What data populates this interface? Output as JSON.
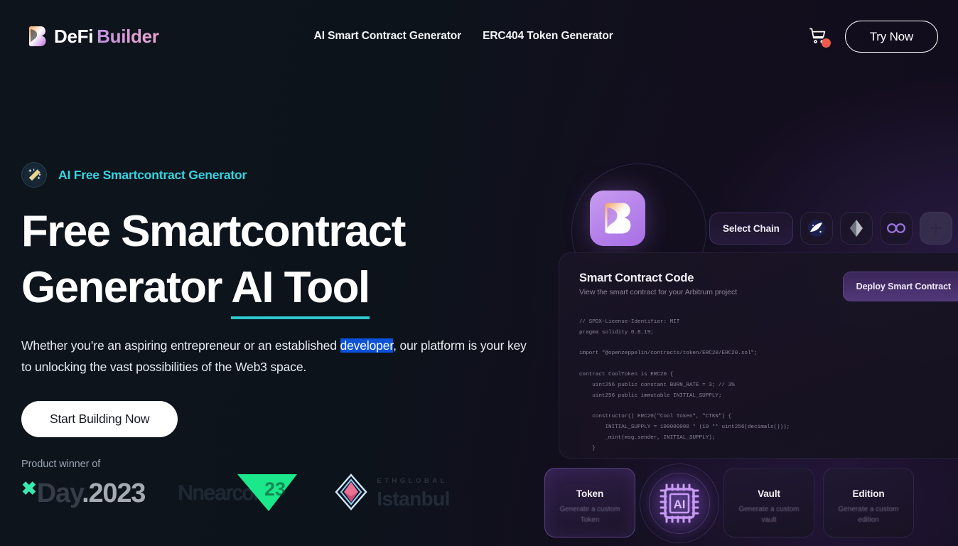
{
  "brand": {
    "name_primary": "DeFi",
    "name_secondary": "Builder",
    "logo_icon": "defi-builder-b-logo"
  },
  "nav": {
    "items": [
      {
        "label": "AI Smart Contract Generator"
      },
      {
        "label": "ERC404 Token Generator"
      }
    ],
    "cart_icon": "shopping-cart-icon",
    "cart_badge": "",
    "cta_label": "Try Now"
  },
  "hero": {
    "eyebrow_icon": "magic-wand-icon",
    "eyebrow": "AI Free Smartcontract Generator",
    "headline_line1": "Free Smartcontract",
    "headline_line2_plain": "Generator ",
    "headline_line2_underlined": "AI Tool",
    "sub_part1": "Whether you’re an aspiring entrepreneur or an established ",
    "sub_selected": "developer",
    "sub_part2": ", our platform is your key to unlocking the vast possibilities of the Web3 space.",
    "cta_label": "Start Building Now"
  },
  "awards": {
    "label": "Product winner of",
    "items": [
      {
        "name": "xday-2023",
        "x": "✖",
        "text_dim": "Day",
        "text_bright": ".2023"
      },
      {
        "name": "nearcon-23",
        "word": "Nnearcon",
        "mark": "23"
      },
      {
        "name": "ethglobal-istanbul",
        "top": "ETHGLOBAL",
        "city": "Istanbul"
      }
    ]
  },
  "app": {
    "app_icon": "defi-builder-app-icon",
    "select_chain_label": "Select Chain",
    "chains": [
      {
        "name": "arbitrum-chain-icon"
      },
      {
        "name": "ethereum-chain-icon"
      },
      {
        "name": "polygon-chain-icon"
      },
      {
        "name": "additional-chain-icon"
      }
    ],
    "code_panel": {
      "title": "Smart Contract Code",
      "subtitle": "View the smart contract for your Arbitrum project",
      "deploy_label": "Deploy Smart Contract",
      "code": "// SPDX-License-Identifier: MIT\npragma solidity 0.8.19;\n\nimport \"@openzeppelin/contracts/token/ERC20/ERC20.sol\";\n\ncontract CoolToken is ERC20 {\n    uint256 public constant BURN_RATE = 3; // 3%\n    uint256 public immutable INITIAL_SUPPLY;\n\n    constructor() ERC20(\"Cool Token\", \"CTKN\") {\n        INITIAL_SUPPLY = 100000000 * (10 ** uint256(decimals()));\n        _mint(msg.sender, INITIAL_SUPPLY);\n    }\n\n    function _transfer(address sender, address recipient, uint256 amount) internal override {\n        uint256 burnAmount = (amount * BURN_RATE) / 100;\n        uint256 sendAmount = amount - burnAmount;\n        require(amount == sendAmount + burnAmount, \"Burn value invalid\");"
    },
    "features": [
      {
        "title": "Token",
        "desc": "Generate a custom Token"
      },
      {
        "title": "Vault",
        "desc": "Generate a custom vault"
      },
      {
        "title": "Edition",
        "desc": "Generate a custom edition"
      }
    ],
    "ai_icon": "ai-chip-icon",
    "ai_icon_label": "AI"
  },
  "colors": {
    "accent_teal": "#35d4e0",
    "accent_purple": "#a86fe4",
    "selection_blue": "#0c52d8",
    "cart_badge_red": "#f05b4f",
    "background": "#0b1219"
  }
}
